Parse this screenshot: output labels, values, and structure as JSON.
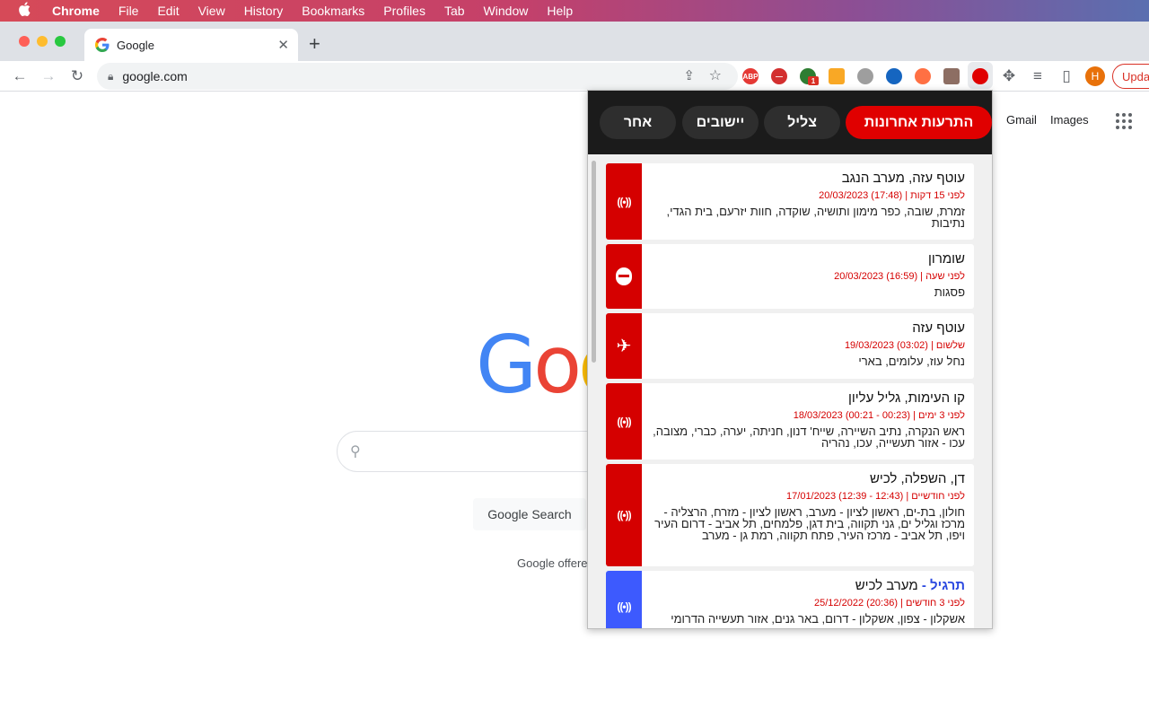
{
  "menubar": {
    "app": "Chrome",
    "items": [
      "File",
      "Edit",
      "View",
      "History",
      "Bookmarks",
      "Profiles",
      "Tab",
      "Window",
      "Help"
    ]
  },
  "tab": {
    "title": "Google",
    "close": "✕",
    "new_tab": "+"
  },
  "toolbar": {
    "back": "←",
    "forward": "→",
    "reload": "↻",
    "url": "google.com",
    "update_label": "Update",
    "profile_initial": "H",
    "extension_badge": "1"
  },
  "google": {
    "links": [
      "Gmail",
      "Images"
    ],
    "search_button": "Google Search",
    "offered_text": "Google offere"
  },
  "popup": {
    "tabs": [
      "התרעות אחרונות",
      "צליל",
      "יישובים",
      "אחר"
    ],
    "alerts": [
      {
        "title": "עוטף עזה, מערב הנגב",
        "time": "לפני 15 דקות | (17:48) 20/03/2023",
        "desc": "זמרת, שובה, כפר מימון ותושיה, שוקדה, חוות יזרעם, בית הגדי, נתיבות",
        "icon": "signal-icon"
      },
      {
        "title": "שומרון",
        "time": "לפני שעה | (16:59) 20/03/2023",
        "desc": "פסגות",
        "icon": "shield-icon"
      },
      {
        "title": "עוטף עזה",
        "time": "שלשום | (03:02) 19/03/2023",
        "desc": "נחל עוז, עלומים, בארי",
        "icon": "plane-icon"
      },
      {
        "title": "קו העימות, גליל עליון",
        "time": "לפני 3 ימים | (00:23 - 00:21) 18/03/2023",
        "desc": "ראש הנקרה, נתיב השיירה, שייח' דנון, חניתה, יערה, כברי, מצובה, עכו - אזור תעשייה, עכו, נהריה",
        "icon": "signal-icon"
      },
      {
        "title": "דן, השפלה, לכיש",
        "time": "לפני חודשיים | (12:43 - 12:39) 17/01/2023",
        "desc": "חולון, בת-ים, ראשון לציון - מערב, ראשון לציון - מזרח, הרצליה - מרכז וגליל ים, גני תקווה, בית דגן, פלמחים, תל אביב - דרום העיר ויפו, תל אביב - מרכז העיר, פתח תקווה, רמת גן - מערב",
        "icon": "signal-icon"
      },
      {
        "title_prefix": "תרגיל -",
        "title": "מערב לכיש",
        "time": "לפני 3 חודשים | (20:36) 25/12/2022",
        "desc": "אשקלון - צפון, אשקלון - דרום, באר גנים, אזור תעשייה הדרומי",
        "icon": "signal-icon"
      }
    ]
  },
  "colors": {
    "alert_red": "#d50000",
    "drill_blue": "#3d5afe",
    "popup_header": "#1b1b1b"
  }
}
